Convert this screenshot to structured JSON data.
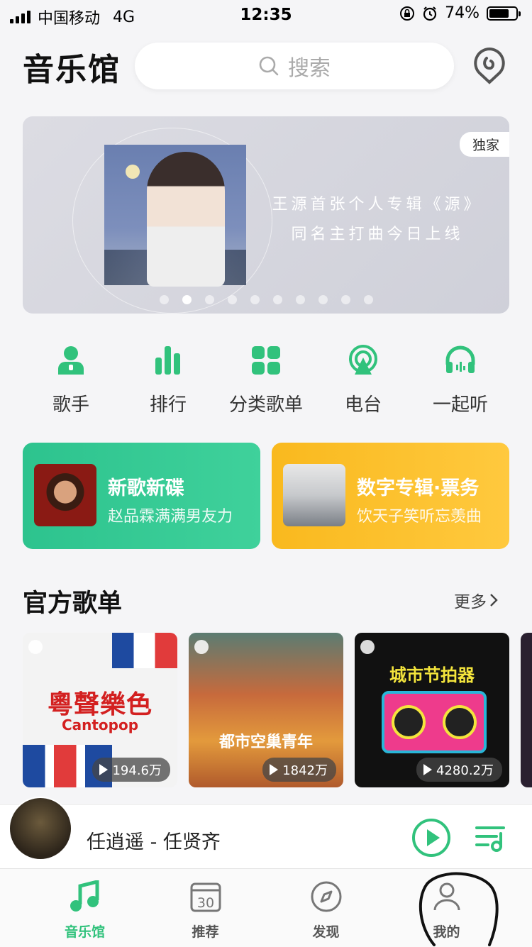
{
  "status_bar": {
    "carrier": "中国移动",
    "network": "4G",
    "time": "12:35",
    "battery": "74%",
    "battery_level": 0.74
  },
  "header": {
    "title": "音乐馆",
    "search_placeholder": "搜索"
  },
  "banner": {
    "badge": "独家",
    "line1": "王源首张个人专辑《源》",
    "line2": "同名主打曲今日上线",
    "page_count": 10,
    "active_index": 1
  },
  "quick_entries": [
    {
      "label": "歌手",
      "icon": "singer-icon"
    },
    {
      "label": "排行",
      "icon": "chart-icon"
    },
    {
      "label": "分类歌单",
      "icon": "category-icon"
    },
    {
      "label": "电台",
      "icon": "radio-icon"
    },
    {
      "label": "一起听",
      "icon": "headphones-icon"
    }
  ],
  "promos": [
    {
      "title": "新歌新碟",
      "subtitle": "赵品霖满满男友力",
      "color": "#2dc38e"
    },
    {
      "title": "数字专辑·票务",
      "subtitle": "饮天子笑听忘羡曲",
      "color": "#fbbd26"
    }
  ],
  "section": {
    "title": "官方歌单",
    "more": "更多"
  },
  "playlists": [
    {
      "art_title": "粵聲樂色",
      "art_subtitle": "Cantopop",
      "plays": "194.6万"
    },
    {
      "art_title": "都市空巢青年",
      "plays": "1842万"
    },
    {
      "art_title": "城市节拍器",
      "plays": "4280.2万"
    }
  ],
  "mini_player": {
    "now_playing": "任逍遥 - 任贤齐"
  },
  "tabs": [
    {
      "label": "音乐馆",
      "icon": "music-note-icon",
      "active": true
    },
    {
      "label": "推荐",
      "icon": "calendar-icon",
      "calendar_day": "30"
    },
    {
      "label": "发现",
      "icon": "compass-icon"
    },
    {
      "label": "我的",
      "icon": "profile-icon"
    }
  ],
  "colors": {
    "accent": "#31c27c",
    "promo_green": "#2dc38e",
    "promo_yellow": "#fbbd26",
    "background": "#f5f5f7"
  }
}
